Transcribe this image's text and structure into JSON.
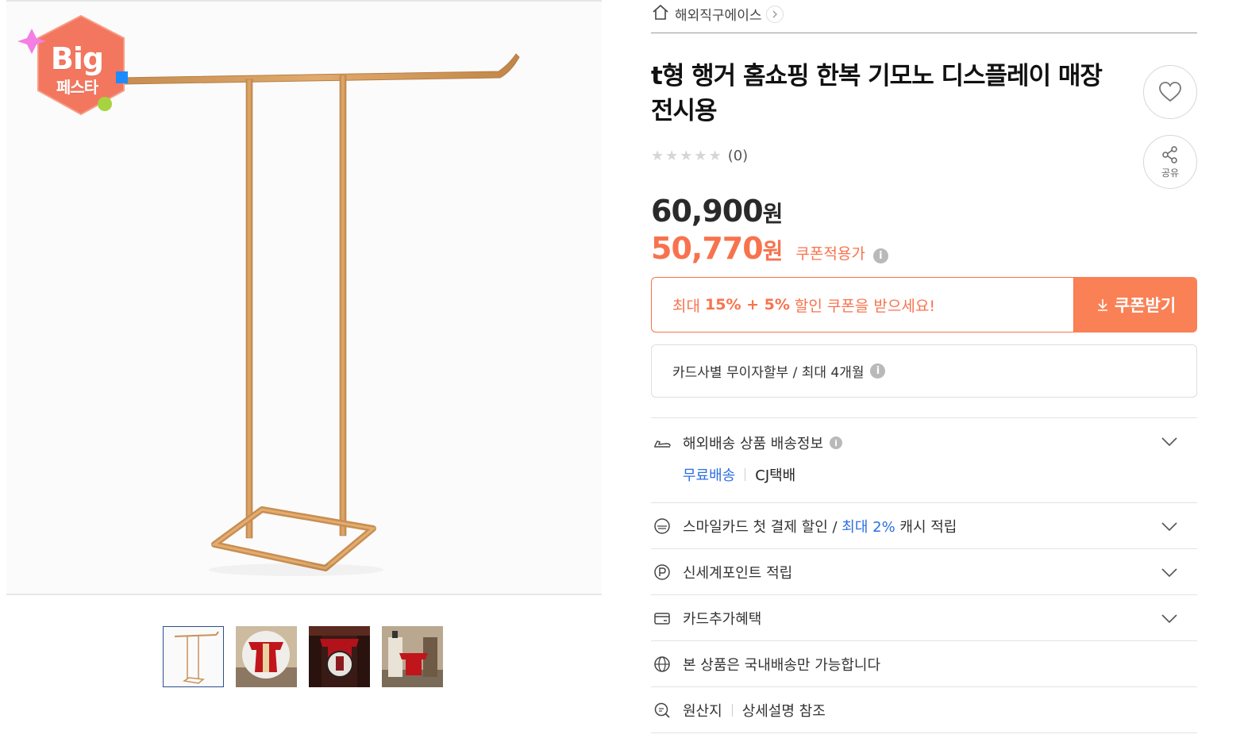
{
  "badge": {
    "line1": "Big",
    "line2": "페스타"
  },
  "gallery": {
    "thumbnails": [
      {
        "name": "thumb-rack"
      },
      {
        "name": "thumb-kimono-arch"
      },
      {
        "name": "thumb-kimono-window"
      },
      {
        "name": "thumb-kimono-hall"
      }
    ]
  },
  "breadcrumb": {
    "store": "해외직구에이스"
  },
  "product": {
    "title_line1": "t형 행거 홈쇼핑 한복 기모노 디스플레이 매장",
    "title_line2": "전시용",
    "rating_count": "(0)",
    "stars_filled": 0,
    "price_original": "60,900",
    "price_original_unit": "원",
    "price_sale": "50,770",
    "price_sale_unit": "원",
    "coupon_price_label": "쿠폰적용가"
  },
  "actions": {
    "share_label": "공유"
  },
  "coupon": {
    "text_prefix": "최대 ",
    "text_highlight": "15% + 5%",
    "text_suffix": " 할인 쿠폰을 받으세요!",
    "button_label": "쿠폰받기"
  },
  "installment": {
    "text": "카드사별 무이자할부 / 최대 4개월"
  },
  "rows": {
    "shipping": {
      "title": "해외배송 상품 배송정보",
      "free": "무료배송",
      "carrier": "CJ택배"
    },
    "smilecard": {
      "text_prefix": "스마일카드 첫 결제 할인 / ",
      "highlight": "최대 2%",
      "text_suffix": " 캐시 적립"
    },
    "points": {
      "text": "신세계포인트 적립"
    },
    "card_benefit": {
      "text": "카드추가혜택"
    },
    "domestic": {
      "text": "본 상품은 국내배송만 가능합니다"
    },
    "origin": {
      "label": "원산지",
      "value": "상세설명 참조"
    }
  },
  "colors": {
    "accent": "#f7734e",
    "accent_button": "#f98155",
    "link_blue": "#2b6fe0"
  }
}
